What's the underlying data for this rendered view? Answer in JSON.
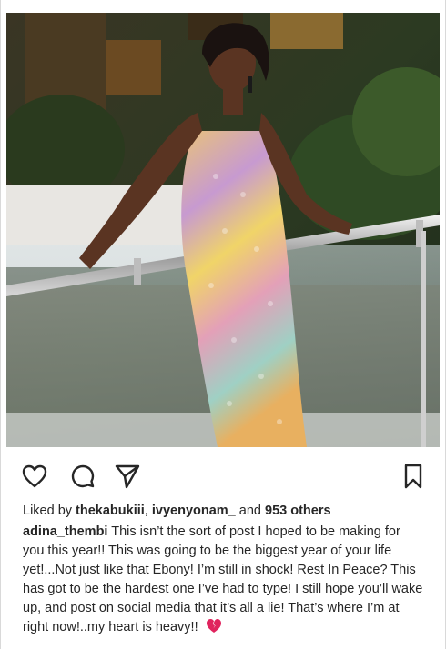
{
  "post": {
    "image_alt_icon": "photo-woman-sequin-dress",
    "actions": {
      "like_icon": "heart-outline-icon",
      "comment_icon": "comment-bubble-icon",
      "share_icon": "paper-plane-icon",
      "save_icon": "bookmark-icon"
    },
    "likes": {
      "prefix": "Liked by ",
      "user1": "thekabukiii",
      "separator": ", ",
      "user2": "ivyenyonam_",
      "middle": " and ",
      "others": "953 others"
    },
    "caption": {
      "username": "adina_thembi",
      "text": " This isn’t the sort of post I hoped to be making for you this year!! This was going to be the biggest year of your life yet!...Not just like that Ebony! I’m still in shock! Rest In Peace? This has got to be the hardest one I’ve had to type! I still hope you’ll wake up, and post on social media that it’s all a lie! That’s where I’m at right now!..my heart is heavy!! ",
      "emoji_icon": "broken-heart-icon"
    },
    "colors": {
      "text": "#262626",
      "broken_heart": "#e0245e"
    }
  }
}
